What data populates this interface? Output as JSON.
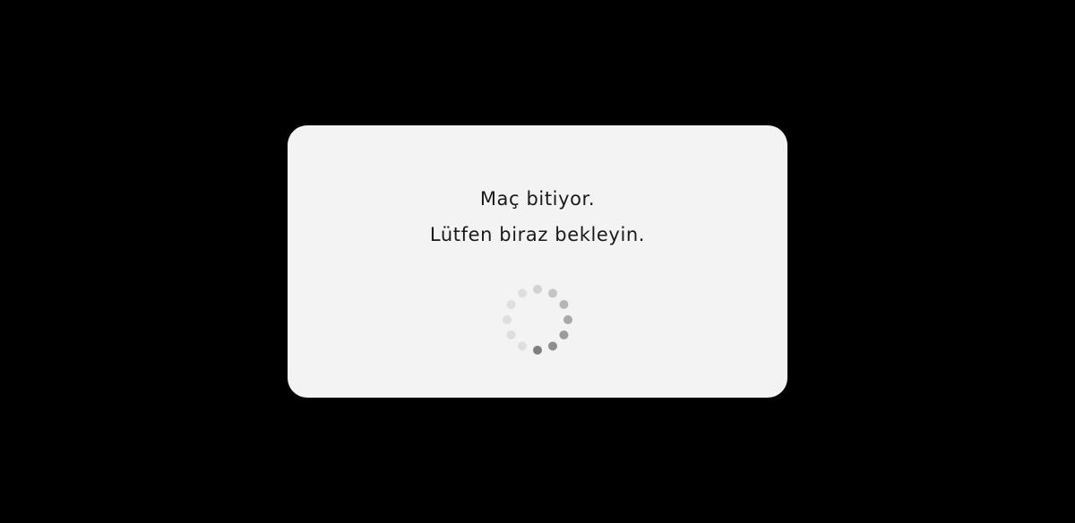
{
  "dialog": {
    "line1": "Maç bitiyor.",
    "line2": "Lütfen biraz bekleyin."
  },
  "spinner": {
    "icon": "loading-spinner-icon",
    "dot_count": 12,
    "active_index": 6,
    "color": "#7f7f7f"
  },
  "colors": {
    "background": "#000000",
    "dialog_background": "#f3f3f3",
    "text": "#1a1a1a"
  }
}
